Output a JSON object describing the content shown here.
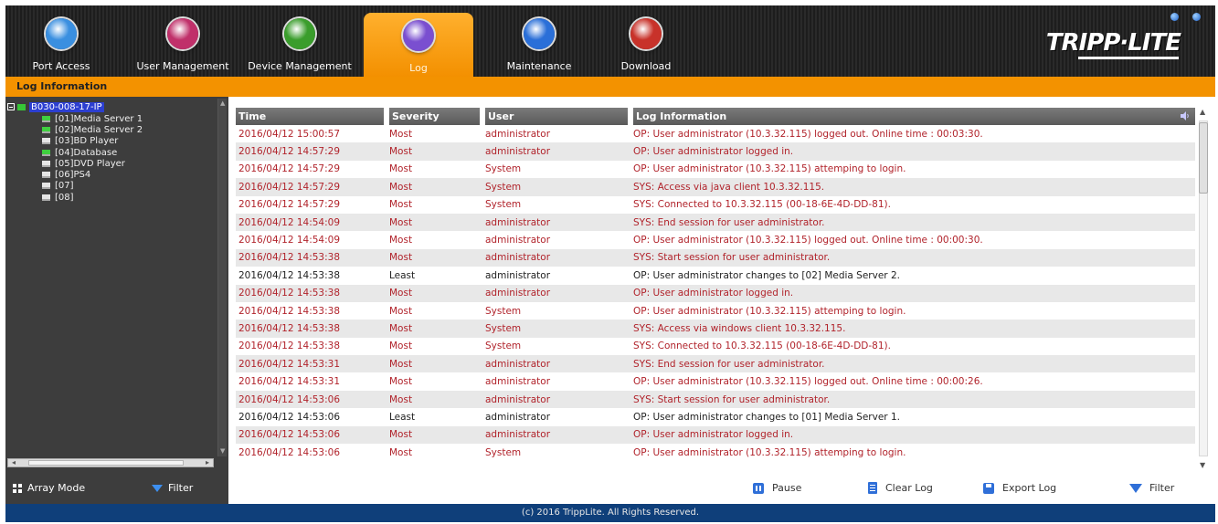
{
  "tabs": [
    {
      "label": "Port Access",
      "icon": "port-access-icon",
      "color": "#3a8fe0"
    },
    {
      "label": "User Management",
      "icon": "user-management-icon",
      "color": "#c0306a"
    },
    {
      "label": "Device Management",
      "icon": "device-management-icon",
      "color": "#3a9d2c"
    },
    {
      "label": "Log",
      "icon": "log-icon",
      "color": "#7a4fd0",
      "active": true
    },
    {
      "label": "Maintenance",
      "icon": "maintenance-icon",
      "color": "#2a6fd8"
    },
    {
      "label": "Download",
      "icon": "download-icon",
      "color": "#c8322a"
    }
  ],
  "brand": "TRIPP·LITE",
  "section_title": "Log Information",
  "tree": {
    "root": "B030-008-17-IP",
    "ports": [
      {
        "label": "[01]Media Server 1",
        "status": "online"
      },
      {
        "label": "[02]Media Server 2",
        "status": "online"
      },
      {
        "label": "[03]BD Player",
        "status": "offline"
      },
      {
        "label": "[04]Database",
        "status": "online"
      },
      {
        "label": "[05]DVD Player",
        "status": "offline"
      },
      {
        "label": "[06]PS4",
        "status": "offline"
      },
      {
        "label": "[07]",
        "status": "offline"
      },
      {
        "label": "[08]",
        "status": "offline"
      }
    ]
  },
  "left_footer": {
    "array_mode": "Array Mode",
    "filter": "Filter"
  },
  "log": {
    "columns": [
      "Time",
      "Severity",
      "User",
      "Log Information"
    ],
    "rows": [
      {
        "time": "2016/04/12 15:00:57",
        "severity": "Most",
        "user": "administrator",
        "info": "OP: User administrator (10.3.32.115) logged out. Online time : 00:03:30."
      },
      {
        "time": "2016/04/12 14:57:29",
        "severity": "Most",
        "user": "administrator",
        "info": "OP: User administrator logged in."
      },
      {
        "time": "2016/04/12 14:57:29",
        "severity": "Most",
        "user": "System",
        "info": "OP: User administrator (10.3.32.115) attemping to login."
      },
      {
        "time": "2016/04/12 14:57:29",
        "severity": "Most",
        "user": "System",
        "info": "SYS: Access via java client 10.3.32.115."
      },
      {
        "time": "2016/04/12 14:57:29",
        "severity": "Most",
        "user": "System",
        "info": "SYS: Connected to 10.3.32.115 (00-18-6E-4D-DD-81)."
      },
      {
        "time": "2016/04/12 14:54:09",
        "severity": "Most",
        "user": "administrator",
        "info": "SYS: End session for user administrator."
      },
      {
        "time": "2016/04/12 14:54:09",
        "severity": "Most",
        "user": "administrator",
        "info": "OP: User administrator (10.3.32.115) logged out. Online time : 00:00:30."
      },
      {
        "time": "2016/04/12 14:53:38",
        "severity": "Most",
        "user": "administrator",
        "info": "SYS: Start session for user administrator."
      },
      {
        "time": "2016/04/12 14:53:38",
        "severity": "Least",
        "user": "administrator",
        "info": "OP: User administrator changes to [02] Media Server 2."
      },
      {
        "time": "2016/04/12 14:53:38",
        "severity": "Most",
        "user": "administrator",
        "info": "OP: User administrator logged in."
      },
      {
        "time": "2016/04/12 14:53:38",
        "severity": "Most",
        "user": "System",
        "info": "OP: User administrator (10.3.32.115) attemping to login."
      },
      {
        "time": "2016/04/12 14:53:38",
        "severity": "Most",
        "user": "System",
        "info": "SYS: Access via windows client 10.3.32.115."
      },
      {
        "time": "2016/04/12 14:53:38",
        "severity": "Most",
        "user": "System",
        "info": "SYS: Connected to 10.3.32.115 (00-18-6E-4D-DD-81)."
      },
      {
        "time": "2016/04/12 14:53:31",
        "severity": "Most",
        "user": "administrator",
        "info": "SYS: End session for user administrator."
      },
      {
        "time": "2016/04/12 14:53:31",
        "severity": "Most",
        "user": "administrator",
        "info": "OP: User administrator (10.3.32.115) logged out. Online time : 00:00:26."
      },
      {
        "time": "2016/04/12 14:53:06",
        "severity": "Most",
        "user": "administrator",
        "info": "SYS: Start session for user administrator."
      },
      {
        "time": "2016/04/12 14:53:06",
        "severity": "Least",
        "user": "administrator",
        "info": "OP: User administrator changes to [01] Media Server 1."
      },
      {
        "time": "2016/04/12 14:53:06",
        "severity": "Most",
        "user": "administrator",
        "info": "OP: User administrator logged in."
      },
      {
        "time": "2016/04/12 14:53:06",
        "severity": "Most",
        "user": "System",
        "info": "OP: User administrator (10.3.32.115) attemping to login."
      }
    ]
  },
  "actions": {
    "pause": "Pause",
    "clear_log": "Clear Log",
    "export_log": "Export Log",
    "filter": "Filter"
  },
  "footer": "(c) 2016 TrippLite. All Rights Reserved.",
  "colors": {
    "accent": "#f39200",
    "most": "#b1232b",
    "least": "#222222",
    "footer": "#0f3f7a"
  }
}
